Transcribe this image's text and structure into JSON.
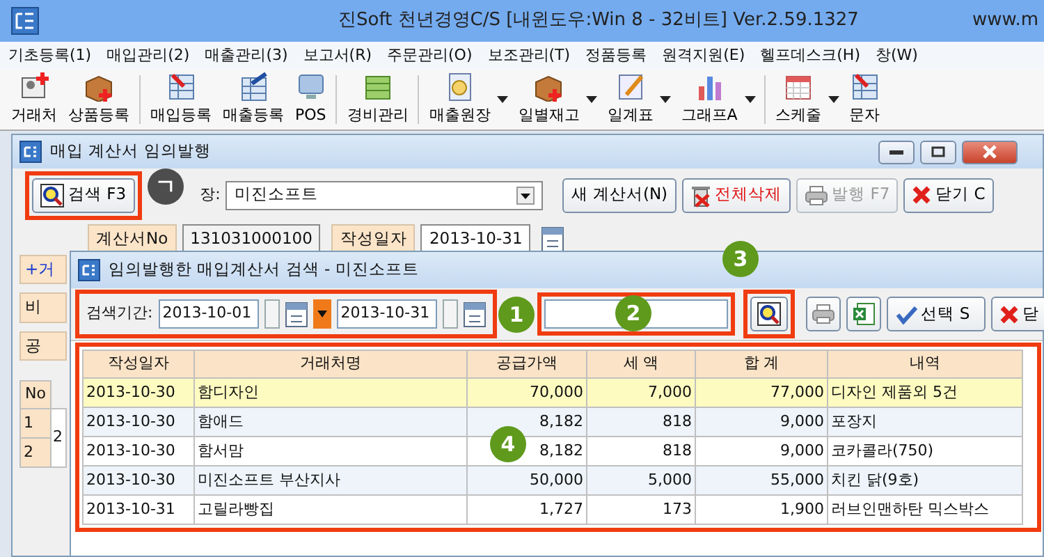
{
  "app_window": {
    "title": "진Soft 천년경영C/S [내윈도우:Win 8 - 32비트] Ver.2.59.1327",
    "title_right": "www.m"
  },
  "menu": [
    "기초등록(1)",
    "매입관리(2)",
    "매출관리(3)",
    "보고서(R)",
    "주문관리(O)",
    "보조관리(T)",
    "정품등록",
    "원격지원(E)",
    "헬프데스크(H)",
    "창(W)"
  ],
  "toolbar": [
    {
      "kind": "button",
      "label": "거래처",
      "dropdown": false
    },
    {
      "kind": "button",
      "label": "상품등록",
      "dropdown": false
    },
    {
      "kind": "separator"
    },
    {
      "kind": "button",
      "label": "매입등록",
      "dropdown": false
    },
    {
      "kind": "button",
      "label": "매출등록",
      "dropdown": false
    },
    {
      "kind": "button",
      "label": "POS",
      "dropdown": false
    },
    {
      "kind": "separator"
    },
    {
      "kind": "button",
      "label": "경비관리",
      "dropdown": false
    },
    {
      "kind": "separator"
    },
    {
      "kind": "button",
      "label": "매출원장",
      "dropdown": true
    },
    {
      "kind": "button",
      "label": "일별재고",
      "dropdown": true
    },
    {
      "kind": "button",
      "label": "일계표",
      "dropdown": true
    },
    {
      "kind": "button",
      "label": "그래프A",
      "dropdown": true
    },
    {
      "kind": "separator"
    },
    {
      "kind": "button",
      "label": "스케줄",
      "dropdown": true
    },
    {
      "kind": "button",
      "label": "문자",
      "dropdown": false
    }
  ],
  "invoice_window": {
    "title": "매입 계산서 임의발행",
    "search_button": {
      "label": "검색 F3",
      "highlighted": true
    },
    "supplier_label": "장:",
    "supplier_value": "미진소프트",
    "buttons": [
      {
        "kind": "new",
        "label": "새 계산서(N)",
        "disabled": false
      },
      {
        "kind": "delete",
        "label": "전체삭제",
        "disabled": false
      },
      {
        "kind": "print",
        "label": "발행 F7",
        "disabled": true
      },
      {
        "kind": "close",
        "label": "닫기 C",
        "disabled": false
      }
    ],
    "fields": [
      {
        "label": "계산서No",
        "value": "131031000100"
      },
      {
        "label": "작성일자",
        "value": "2013-10-31"
      }
    ],
    "side_labels": [
      {
        "text": "+거",
        "required": true
      },
      {
        "text": "비",
        "required": false
      },
      {
        "text": "공",
        "required": false
      }
    ],
    "mini_table": {
      "header": "No",
      "rows": [
        "1",
        "2"
      ],
      "cell": "2"
    }
  },
  "search_dialog": {
    "title": "임의발행한 매입계산서 검색 - 미진소프트",
    "period_label": "검색기간:",
    "date_from": "2013-10-01",
    "date_to": "2013-10-31",
    "period_highlighted": true,
    "keyword_highlighted": true,
    "search_highlighted": true,
    "buttons": [
      {
        "kind": "select",
        "label": "선택 S"
      },
      {
        "kind": "close",
        "label": "닫"
      }
    ],
    "table": {
      "highlighted": true,
      "columns": [
        {
          "label": "작성일자",
          "numeric": false
        },
        {
          "label": "거래처명",
          "numeric": false
        },
        {
          "label": "공급가액",
          "numeric": true
        },
        {
          "label": "세 액",
          "numeric": true
        },
        {
          "label": "합 계",
          "numeric": true
        },
        {
          "label": "내역",
          "numeric": false
        }
      ],
      "rows": [
        {
          "selected": true,
          "cells": [
            "2013-10-30",
            "함디자인",
            "70,000",
            "7,000",
            "77,000",
            "디자인 제품외 5건"
          ]
        },
        {
          "selected": false,
          "cells": [
            "2013-10-30",
            "함애드",
            "8,182",
            "818",
            "9,000",
            "포장지"
          ]
        },
        {
          "selected": false,
          "cells": [
            "2013-10-30",
            "함서맘",
            "8,182",
            "818",
            "9,000",
            "코카콜라(750)"
          ]
        },
        {
          "selected": false,
          "cells": [
            "2013-10-30",
            "미진소프트 부산지사",
            "50,000",
            "5,000",
            "55,000",
            "치킨 닭(9호)"
          ]
        },
        {
          "selected": false,
          "cells": [
            "2013-10-31",
            "고릴라빵집",
            "1,727",
            "173",
            "1,900",
            "러브인맨하탄 믹스박스"
          ]
        }
      ]
    }
  },
  "callouts": [
    {
      "label": "ㄱ",
      "color": "#4d4d4d"
    },
    {
      "label": "1",
      "color": "#5f9a1c"
    },
    {
      "label": "2",
      "color": "#5f9a1c"
    },
    {
      "label": "3",
      "color": "#5f9a1c"
    },
    {
      "label": "4",
      "color": "#5f9a1c"
    }
  ]
}
